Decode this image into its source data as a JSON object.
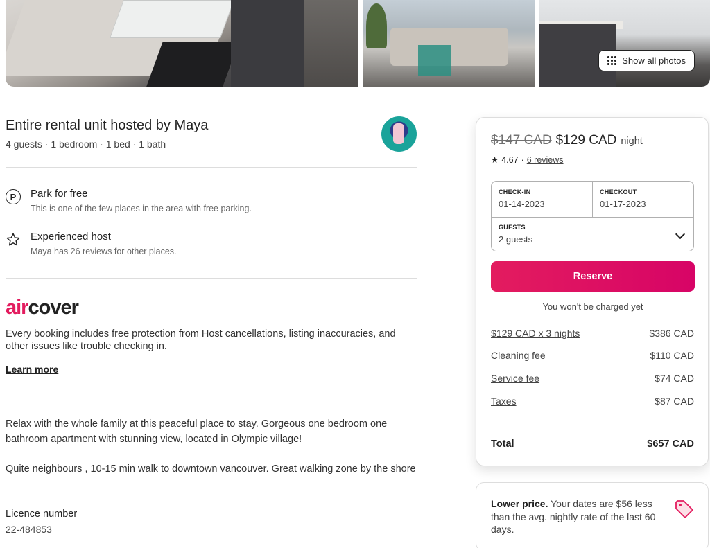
{
  "photos": {
    "show_all_label": "Show all photos"
  },
  "host": {
    "title": "Entire rental unit hosted by Maya",
    "subtitle": "4 guests · 1 bedroom · 1 bed · 1 bath"
  },
  "features": [
    {
      "title": "Park for free",
      "description": "This is one of the few places in the area with free parking.",
      "icon": "parking-icon"
    },
    {
      "title": "Experienced host",
      "description": "Maya has 26 reviews for other places.",
      "icon": "star-icon"
    }
  ],
  "aircover": {
    "logo_air": "air",
    "logo_cover": "cover",
    "text": "Every booking includes free protection from Host cancellations, listing inaccuracies, and other issues like trouble checking in.",
    "learn_more": "Learn more"
  },
  "description": {
    "paragraph1": "Relax with the whole family at this peaceful place to stay. Gorgeous one bedroom one bathroom  apartment with stunning view,  located in Olympic village!",
    "paragraph2": "Quite neighbours , 10-15 min walk  to downtown vancouver. Great walking zone by the shore",
    "licence_label": "Licence number",
    "licence_number": "22-484853"
  },
  "booking": {
    "old_price": "$147 CAD",
    "new_price": "$129 CAD",
    "per": "night",
    "rating": "4.67",
    "separator": "·",
    "reviews": "6 reviews",
    "checkin_label": "CHECK-IN",
    "checkin_value": "01-14-2023",
    "checkout_label": "CHECKOUT",
    "checkout_value": "01-17-2023",
    "guests_label": "GUESTS",
    "guests_value": "2 guests",
    "reserve_label": "Reserve",
    "no_charge": "You won't be charged yet",
    "fees": [
      {
        "label": "$129 CAD x 3 nights",
        "amount": "$386 CAD"
      },
      {
        "label": "Cleaning fee",
        "amount": "$110 CAD"
      },
      {
        "label": "Service fee",
        "amount": "$74 CAD"
      },
      {
        "label": "Taxes",
        "amount": "$87 CAD"
      }
    ],
    "total_label": "Total",
    "total_amount": "$657 CAD",
    "accent_color": "#e31c5f"
  },
  "lower_price": {
    "title": "Lower price.",
    "text": "Your dates are $56 less than the avg. nightly rate of the last 60 days."
  }
}
